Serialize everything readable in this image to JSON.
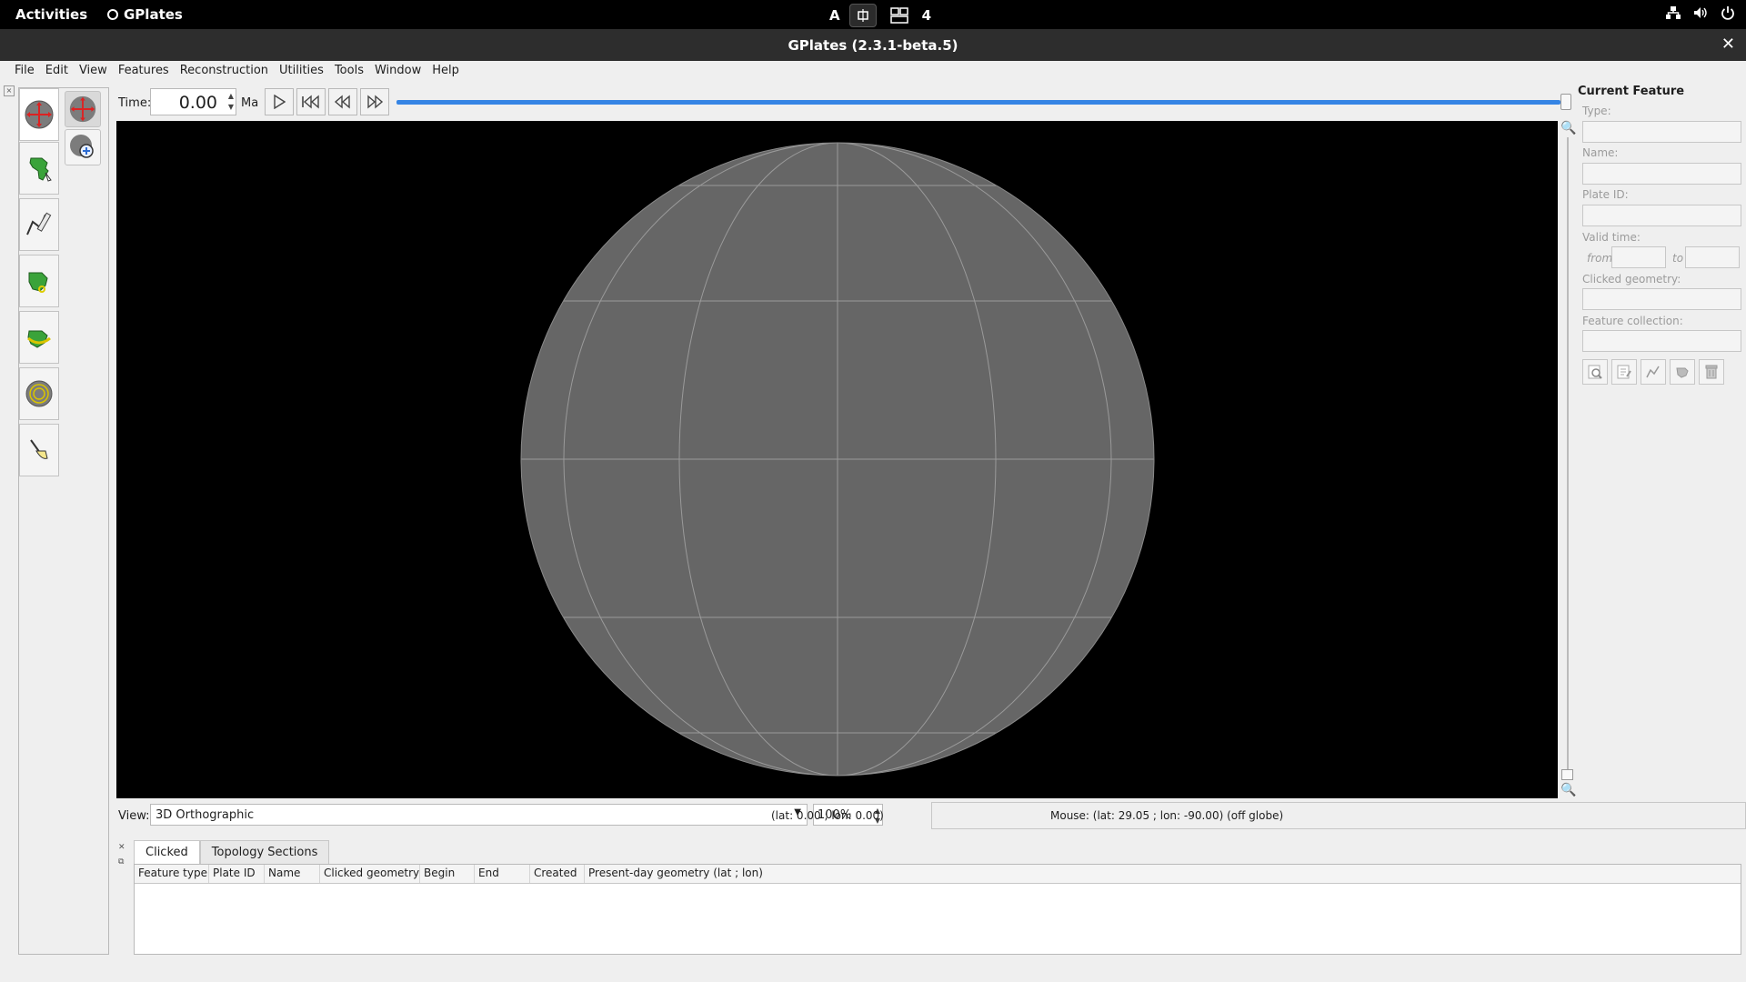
{
  "topbar": {
    "activities": "Activities",
    "app_name": "GPlates",
    "ws_left_char": "A",
    "ws_right_char": "4"
  },
  "window": {
    "title": "GPlates (2.3.1-beta.5)"
  },
  "menu": [
    "File",
    "Edit",
    "View",
    "Features",
    "Reconstruction",
    "Utilities",
    "Tools",
    "Window",
    "Help"
  ],
  "time": {
    "label": "Time:",
    "value": "0.00",
    "unit": "Ma",
    "slider_position": 1.0
  },
  "feature_panel": {
    "heading": "Current Feature",
    "type_label": "Type:",
    "name_label": "Name:",
    "plate_id_label": "Plate ID:",
    "valid_time_label": "Valid time:",
    "from_label": "from",
    "to_label": "to",
    "clicked_geometry_label": "Clicked geometry:",
    "feature_collection_label": "Feature collection:"
  },
  "view": {
    "label": "View:",
    "projection": "3D Orthographic",
    "zoom": "100%",
    "camera_coord": "(lat: 0.00 ; lon: 0.00)",
    "mouse": "Mouse: (lat: 29.05 ; lon: -90.00) (off globe)"
  },
  "bottom": {
    "tabs": [
      "Clicked",
      "Topology Sections"
    ],
    "active_tab": 0,
    "columns": [
      "Feature type",
      "Plate ID",
      "Name",
      "Clicked geometry",
      "Begin",
      "End",
      "Created",
      "Present-day geometry (lat ; lon)"
    ]
  },
  "colors": {
    "globe": "#666666",
    "graticule": "#9a9a9a",
    "canvas": "#000000",
    "accent": "#3584e4"
  }
}
